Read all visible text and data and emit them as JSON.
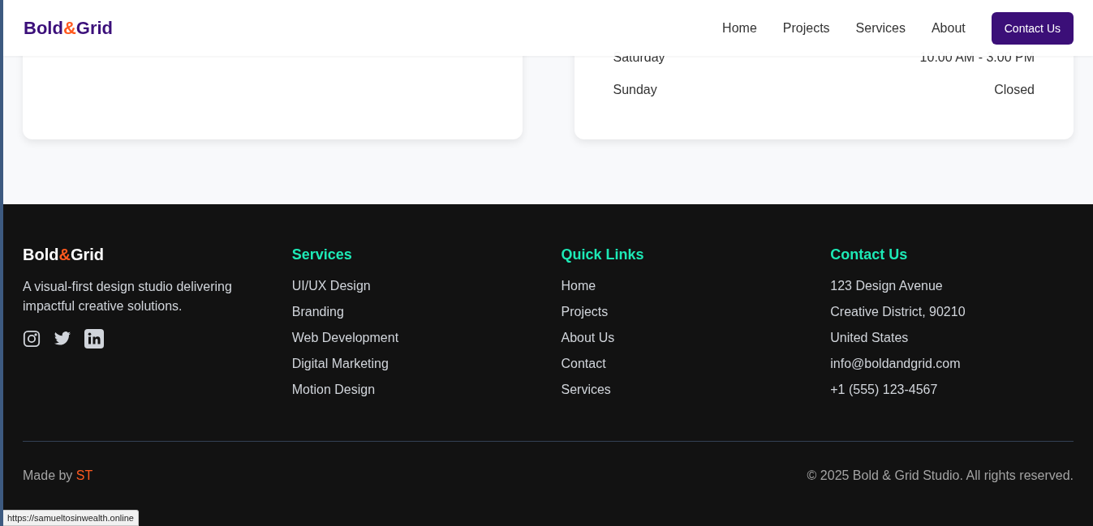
{
  "header": {
    "logo": {
      "first": "Bold",
      "amp": "&",
      "second": "Grid"
    },
    "nav": [
      {
        "label": "Home"
      },
      {
        "label": "Projects"
      },
      {
        "label": "Services"
      },
      {
        "label": "About"
      }
    ],
    "cta": "Contact Us"
  },
  "hours": [
    {
      "day": "Saturday",
      "time": "10:00 AM - 3:00 PM"
    },
    {
      "day": "Sunday",
      "time": "Closed"
    }
  ],
  "footer": {
    "logo": {
      "first": "Bold",
      "amp": "&",
      "second": "Grid"
    },
    "tagline": "A visual-first design studio delivering impactful creative solutions.",
    "social": [
      {
        "kind": "instagram"
      },
      {
        "kind": "twitter"
      },
      {
        "kind": "linkedin"
      }
    ],
    "columns": [
      {
        "title": "Services",
        "items": [
          "UI/UX Design",
          "Branding",
          "Web Development",
          "Digital Marketing",
          "Motion Design"
        ]
      },
      {
        "title": "Quick Links",
        "items": [
          "Home",
          "Projects",
          "About Us",
          "Contact",
          "Services"
        ]
      },
      {
        "title": "Contact Us",
        "items": [
          "123 Design Avenue",
          "Creative District, 90210",
          "United States",
          "info@boldandgrid.com",
          "+1 (555) 123-4567"
        ]
      }
    ],
    "made_by": {
      "label": "Made by",
      "name": "ST"
    },
    "copyright": "© 2025 Bold & Grid Studio. All rights reserved."
  },
  "status_url": "https://samueltosinwealth.online"
}
